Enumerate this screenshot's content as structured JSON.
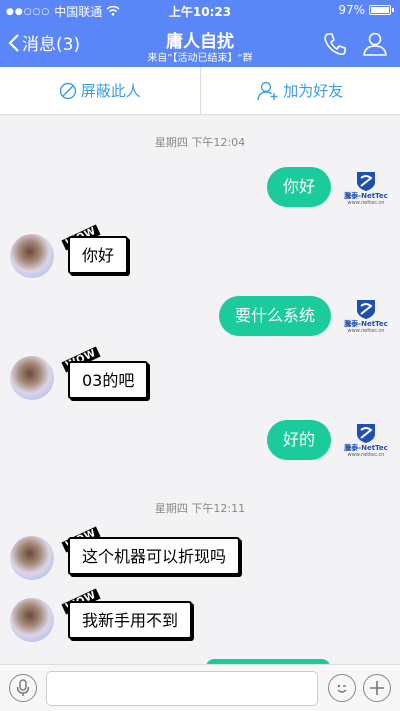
{
  "status": {
    "carrier": "中国联通",
    "time": "上午10:23",
    "battery": "97%"
  },
  "header": {
    "back_label": "消息(3)",
    "title": "庸人自扰",
    "subtitle": "来自”【活动已结束】“群"
  },
  "actions": {
    "block_label": "屏蔽此人",
    "add_friend_label": "加为好友"
  },
  "chat": {
    "timestamps": [
      "星期四 下午12:04",
      "星期四 下午12:11"
    ],
    "messages": [
      {
        "dir": "out",
        "text": "你好"
      },
      {
        "dir": "in",
        "text": "你好"
      },
      {
        "dir": "out",
        "text": "要什么系统"
      },
      {
        "dir": "in",
        "text": "03的吧"
      },
      {
        "dir": "out",
        "text": "好的"
      },
      {
        "dir": "in",
        "text": "这个机器可以折现吗"
      },
      {
        "dir": "in",
        "text": "我新手用不到"
      }
    ]
  },
  "badges": {
    "wow": "WOW",
    "logo_name": "騰泰-NetTec",
    "logo_site": "www.nettec.cn"
  },
  "colors": {
    "header": "#5b86f7",
    "bubble_out": "#1ccb9c",
    "action_text": "#3b9ee8"
  },
  "icons": [
    "signal-icon",
    "wifi-icon",
    "back-chevron-icon",
    "phone-icon",
    "person-icon",
    "block-icon",
    "add-friend-icon",
    "microphone-icon",
    "emoji-icon",
    "plus-icon"
  ]
}
